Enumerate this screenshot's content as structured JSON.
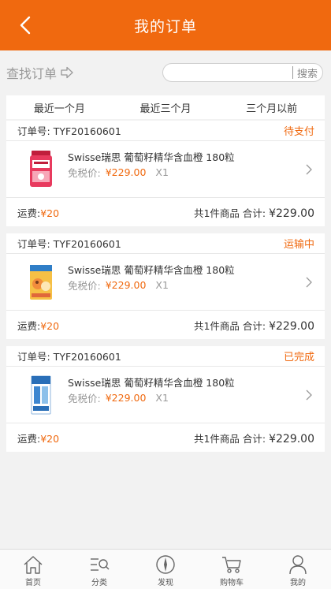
{
  "header": {
    "title": "我的订单",
    "back_icon": "chevron-left-icon"
  },
  "search": {
    "find_label": "查找订单",
    "arrow_icon": "arrow-right-icon",
    "placeholder": "",
    "search_icon": "search-icon",
    "button_label": "搜索"
  },
  "tabs": [
    {
      "label": "最近一个月"
    },
    {
      "label": "最近三个月"
    },
    {
      "label": "三个月以前"
    }
  ],
  "orders": [
    {
      "order_no": "订单号: TYF20160601",
      "status": "待支付",
      "product_name": "Swisse瑞思 葡萄籽精华含血橙 180粒",
      "price_label": "免税价:",
      "price": "¥229.00",
      "qty": "X1",
      "shipping_label": "运费:",
      "shipping": "¥20",
      "count_label": "共1件商品",
      "total_label": "合计:",
      "total": "¥229.00"
    },
    {
      "order_no": "订单号: TYF20160601",
      "status": "运输中",
      "product_name": "Swisse瑞思 葡萄籽精华含血橙 180粒",
      "price_label": "免税价:",
      "price": "¥229.00",
      "qty": "X1",
      "shipping_label": "运费:",
      "shipping": "¥20",
      "count_label": "共1件商品",
      "total_label": "合计:",
      "total": "¥229.00"
    },
    {
      "order_no": "订单号: TYF20160601",
      "status": "已完成",
      "product_name": "Swisse瑞思 葡萄籽精华含血橙 180粒",
      "price_label": "免税价:",
      "price": "¥229.00",
      "qty": "X1",
      "shipping_label": "运费:",
      "shipping": "¥20",
      "count_label": "共1件商品",
      "total_label": "合计:",
      "total": "¥229.00"
    }
  ],
  "nav": [
    {
      "label": "首页",
      "icon": "home-icon"
    },
    {
      "label": "分类",
      "icon": "category-icon"
    },
    {
      "label": "发现",
      "icon": "compass-icon"
    },
    {
      "label": "购物车",
      "icon": "cart-icon"
    },
    {
      "label": "我的",
      "icon": "user-icon"
    }
  ],
  "colors": {
    "brand": "#f0690f",
    "background": "#f2f2f2"
  }
}
